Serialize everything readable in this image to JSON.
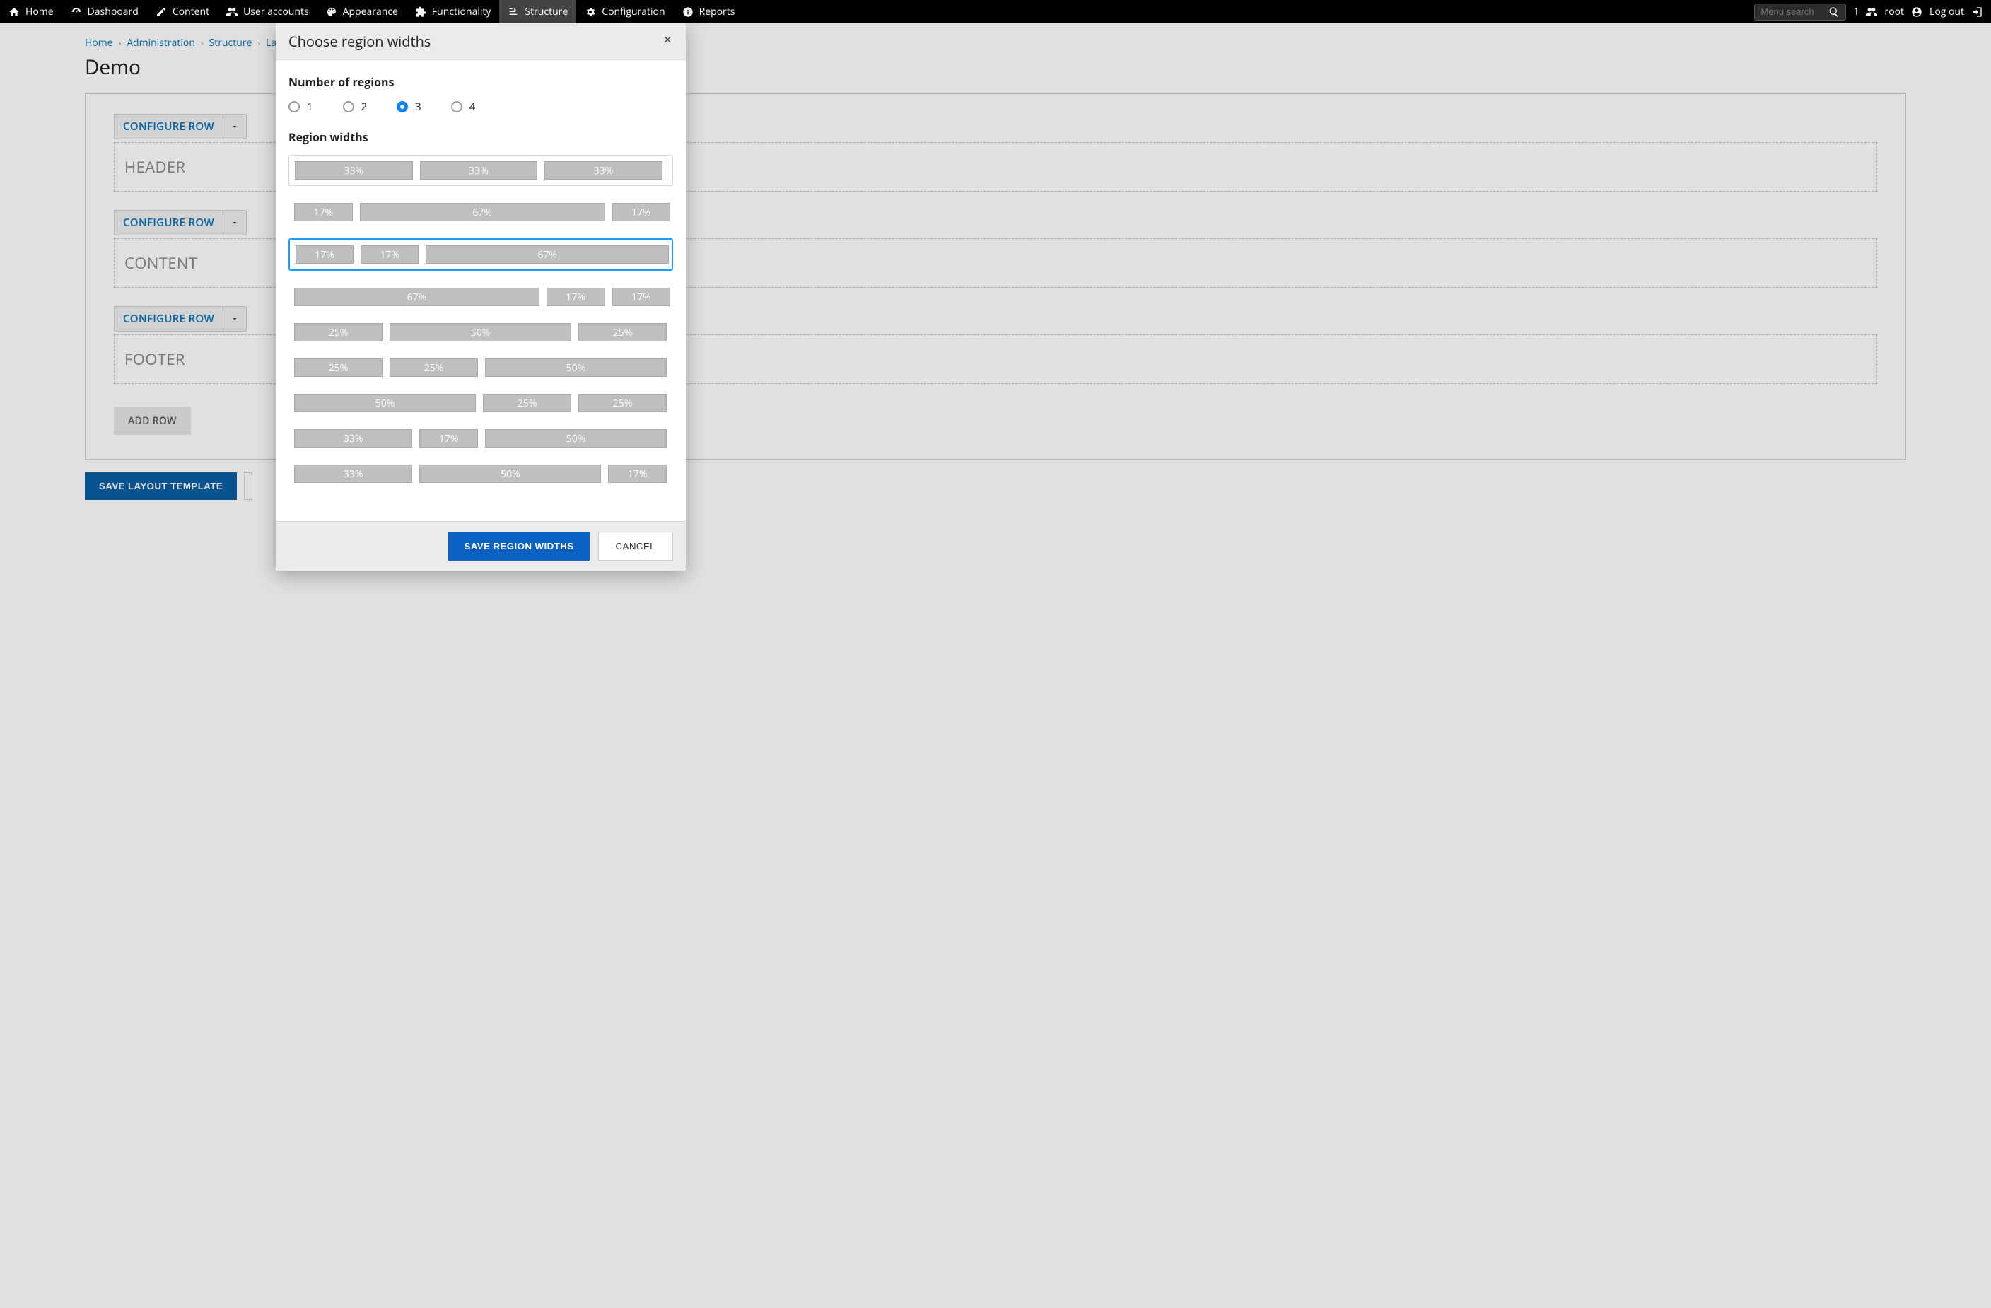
{
  "adminBar": {
    "left": [
      {
        "icon": "home",
        "label": "Home"
      },
      {
        "icon": "dashboard",
        "label": "Dashboard"
      },
      {
        "icon": "pencil",
        "label": "Content"
      },
      {
        "icon": "users",
        "label": "User accounts"
      },
      {
        "icon": "palette",
        "label": "Appearance"
      },
      {
        "icon": "puzzle",
        "label": "Functionality"
      },
      {
        "icon": "structure",
        "label": "Structure",
        "active": true
      },
      {
        "icon": "gear",
        "label": "Configuration"
      },
      {
        "icon": "info",
        "label": "Reports"
      }
    ],
    "search_placeholder": "Menu search",
    "count": "1",
    "user": "root",
    "logout": "Log out"
  },
  "breadcrumb": [
    {
      "label": "Home",
      "link": true
    },
    {
      "label": "Administration",
      "link": true
    },
    {
      "label": "Structure",
      "link": true
    },
    {
      "label": "Layouts",
      "link": true
    }
  ],
  "page_title": "Demo",
  "rows": [
    {
      "config": "CONFIGURE ROW",
      "region": "HEADER"
    },
    {
      "config": "CONFIGURE ROW",
      "region": "CONTENT"
    },
    {
      "config": "CONFIGURE ROW",
      "region": "FOOTER"
    }
  ],
  "add_row": "ADD ROW",
  "save_template": "SAVE LAYOUT TEMPLATE",
  "modal": {
    "title": "Choose region widths",
    "num_regions_label": "Number of regions",
    "num_regions": [
      "1",
      "2",
      "3",
      "4"
    ],
    "num_regions_selected": "3",
    "region_widths_label": "Region widths",
    "options": [
      {
        "cols": [
          "33%",
          "33%",
          "33%"
        ],
        "framed": true
      },
      {
        "cols": [
          "17%",
          "67%",
          "17%"
        ]
      },
      {
        "cols": [
          "17%",
          "17%",
          "67%"
        ],
        "selected": true,
        "framed": true
      },
      {
        "cols": [
          "67%",
          "17%",
          "17%"
        ]
      },
      {
        "cols": [
          "25%",
          "50%",
          "25%"
        ]
      },
      {
        "cols": [
          "25%",
          "25%",
          "50%"
        ]
      },
      {
        "cols": [
          "50%",
          "25%",
          "25%"
        ]
      },
      {
        "cols": [
          "33%",
          "17%",
          "50%"
        ]
      },
      {
        "cols": [
          "33%",
          "50%",
          "17%"
        ]
      }
    ],
    "save": "SAVE REGION WIDTHS",
    "cancel": "CANCEL"
  }
}
